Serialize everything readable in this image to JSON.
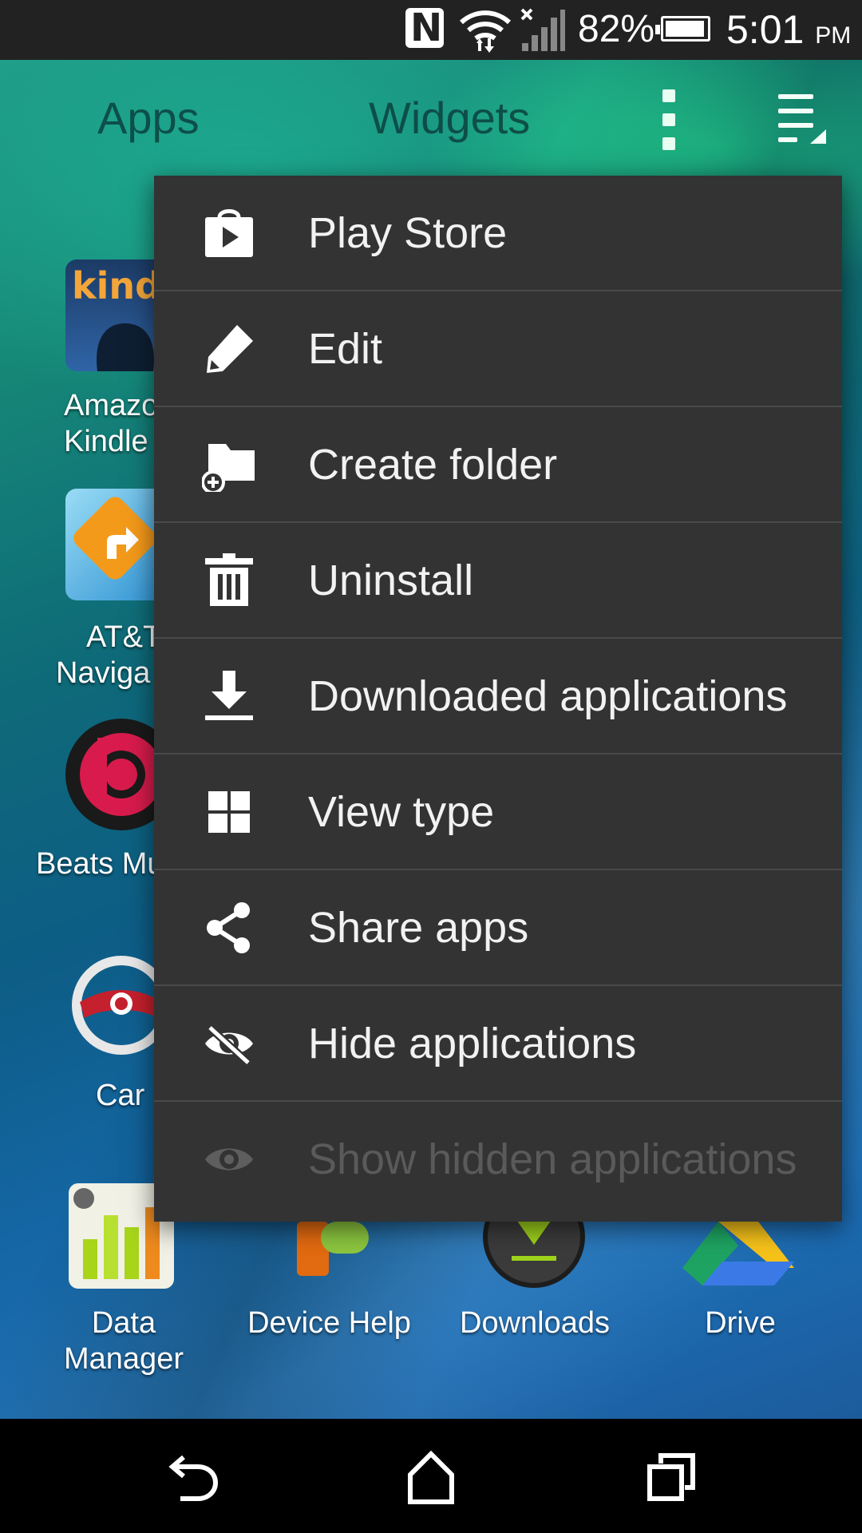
{
  "status_bar": {
    "nfc_icon": "nfc-icon",
    "wifi_icon": "wifi-icon",
    "signal_icon": "signal-no-service-icon",
    "battery_percent": "82%",
    "battery_icon": "battery-icon",
    "time": "5:01",
    "time_suffix": "PM"
  },
  "header": {
    "tabs": [
      {
        "label": "Apps"
      },
      {
        "label": "Widgets"
      }
    ],
    "overflow_icon": "more-vert-icon",
    "list_icon": "sort-list-icon"
  },
  "apps": [
    {
      "label_line1": "Amazo",
      "label_line2": "Kindle"
    },
    {
      "label_line1": "AT&T",
      "label_line2": "Naviga"
    },
    {
      "label_line1": "Beats Mu",
      "label_line2": ""
    },
    {
      "label_line1": "Car",
      "label_line2": ""
    }
  ],
  "bottom_apps": [
    {
      "label_line1": "Data",
      "label_line2": "Manager"
    },
    {
      "label_line1": "Device Help",
      "label_line2": ""
    },
    {
      "label_line1": "Downloads",
      "label_line2": ""
    },
    {
      "label_line1": "Drive",
      "label_line2": ""
    }
  ],
  "kindle_logo_text": "kindle",
  "menu": {
    "items": [
      {
        "label": "Play Store",
        "icon": "play-store-icon",
        "enabled": true
      },
      {
        "label": "Edit",
        "icon": "pencil-icon",
        "enabled": true
      },
      {
        "label": "Create folder",
        "icon": "create-folder-icon",
        "enabled": true
      },
      {
        "label": "Uninstall",
        "icon": "trash-icon",
        "enabled": true
      },
      {
        "label": "Downloaded applications",
        "icon": "download-icon",
        "enabled": true
      },
      {
        "label": "View type",
        "icon": "grid-icon",
        "enabled": true
      },
      {
        "label": "Share apps",
        "icon": "share-icon",
        "enabled": true
      },
      {
        "label": "Hide applications",
        "icon": "eye-off-icon",
        "enabled": true
      },
      {
        "label": "Show hidden applications",
        "icon": "eye-icon",
        "enabled": false
      }
    ]
  },
  "nav_bar": {
    "back_icon": "back-icon",
    "home_icon": "home-icon",
    "recents_icon": "recents-icon"
  },
  "colors": {
    "menu_background": "#333333",
    "menu_divider": "#4a4a4a",
    "menu_text": "#f2f2f2",
    "menu_text_disabled": "#5a5a5a",
    "status_bar": "#222222",
    "nav_bar": "#000000"
  }
}
